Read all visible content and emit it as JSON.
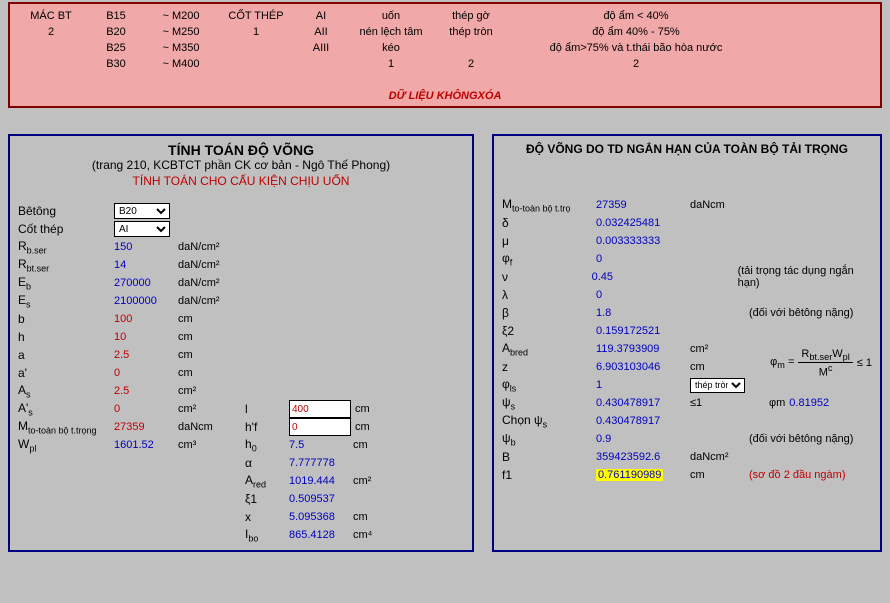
{
  "top": {
    "cols": [
      {
        "h": "MÁC BT",
        "r": [
          "2",
          "",
          "",
          ""
        ]
      },
      {
        "h": "B15",
        "r": [
          "B20",
          "B25",
          "B30",
          ""
        ]
      },
      {
        "h": "~ M200",
        "r": [
          "~ M250",
          "~ M350",
          "~ M400",
          ""
        ]
      },
      {
        "h": "CỐT THÉP",
        "r": [
          "1",
          "",
          "",
          ""
        ]
      },
      {
        "h": "AI",
        "r": [
          "AII",
          "AIII",
          "",
          ""
        ]
      },
      {
        "h": "uốn",
        "r": [
          "nén lệch tâm",
          "kéo",
          "1",
          ""
        ]
      },
      {
        "h": "thép gờ",
        "r": [
          "thép tròn",
          "",
          "2",
          ""
        ]
      },
      {
        "h": "độ ẩm < 40%",
        "r": [
          "độ ẩm 40% - 75%",
          "độ ẩm>75% và t.thái bão hòa nước",
          "2",
          ""
        ]
      }
    ],
    "footer": "DỮ LIỆU KHÔNGXÓA"
  },
  "left": {
    "title": "TÍNH TOÁN ĐỘ VÕNG",
    "sub1": "(trang 210, KCBTCT phần CK cơ bản - Ngô Thế Phong)",
    "sub2": "TÍNH TOÁN CHO CẤU KIỆN CHỊU UỐN",
    "bt_label": "Bêtông",
    "bt_sel": "B20",
    "ct_label": "Cốt thép",
    "ct_sel": "AI",
    "rows": [
      {
        "lab": "R<sub>b.ser</sub>",
        "val": "150",
        "unit": "daN/cm²",
        "red": false
      },
      {
        "lab": "R<sub>bt.ser</sub>",
        "val": "14",
        "unit": "daN/cm²",
        "red": false
      },
      {
        "lab": "E<sub>b</sub>",
        "val": "270000",
        "unit": "daN/cm²",
        "red": false
      },
      {
        "lab": "E<sub>s</sub>",
        "val": "2100000",
        "unit": "daN/cm²",
        "red": false
      },
      {
        "lab": "b",
        "val": "100",
        "unit": "cm",
        "red": true
      },
      {
        "lab": "h",
        "val": "10",
        "unit": "cm",
        "red": true
      },
      {
        "lab": "a",
        "val": "2.5",
        "unit": "cm",
        "red": true
      },
      {
        "lab": "a'",
        "val": "0",
        "unit": "cm",
        "red": true
      },
      {
        "lab": "A<sub>s</sub>",
        "val": "2.5",
        "unit": "cm²",
        "red": true
      },
      {
        "lab": "A'<sub>s</sub>",
        "val": "0",
        "unit": "cm²",
        "red": true
      },
      {
        "lab": "M<sub>to-toàn bộ t.trọng</sub>",
        "val": "27359",
        "unit": "daNcm",
        "red": true
      },
      {
        "lab": "W<sub>pl</sub>",
        "val": "1601.52",
        "unit": "cm³",
        "red": false
      }
    ],
    "col2": [
      {
        "lab": "l",
        "val": "400",
        "unit": "cm",
        "red": true,
        "inp": true
      },
      {
        "lab": "h'f",
        "val": "0",
        "unit": "cm",
        "red": true,
        "inp": true
      },
      {
        "lab": "h<sub>0</sub>",
        "val": "7.5",
        "unit": "cm",
        "red": false,
        "inp": false
      },
      {
        "lab": "α",
        "val": "7.777778",
        "unit": "",
        "red": false,
        "inp": false
      },
      {
        "lab": "A<sub>red</sub>",
        "val": "1019.444",
        "unit": "cm²",
        "red": false,
        "inp": false
      },
      {
        "lab": "ξ1",
        "val": "0.509537",
        "unit": "",
        "red": false,
        "inp": false
      },
      {
        "lab": "x",
        "val": "5.095368",
        "unit": "cm",
        "red": false,
        "inp": false
      },
      {
        "lab": "I<sub>bo</sub>",
        "val": "865.4128",
        "unit": "cm⁴",
        "red": false,
        "inp": false
      }
    ]
  },
  "right": {
    "title": "ĐỘ VÕNG DO TD NGẮN HẠN CỦA TOÀN BỘ TẢI TRỌNG",
    "rows": [
      {
        "lab": "M<sub>to-toàn bộ t.trọ</sub>",
        "val": "27359",
        "unit": "daNcm"
      },
      {
        "lab": "δ",
        "val": "0.032425481",
        "unit": ""
      },
      {
        "lab": "μ",
        "val": "0.003333333",
        "unit": ""
      },
      {
        "lab": "φ<sub>f</sub>",
        "val": "0",
        "unit": ""
      },
      {
        "lab": "ν",
        "val": "0.45",
        "unit": "",
        "extra": "(tải trọng tác dụng ngắn hạn)"
      },
      {
        "lab": "λ",
        "val": "0",
        "unit": ""
      },
      {
        "lab": "β",
        "val": "1.8",
        "unit": "",
        "extra": "(đối với bêtông nặng)"
      },
      {
        "lab": "ξ2",
        "val": "0.159172521",
        "unit": ""
      },
      {
        "lab": "A<sub>bred</sub>",
        "val": "119.3793909",
        "unit": "cm²"
      },
      {
        "lab": "z",
        "val": "6.903103046",
        "unit": "cm"
      },
      {
        "lab": "φ<sub>ls</sub>",
        "val": "1",
        "unit": "",
        "sel": "thép tròn"
      },
      {
        "lab": "ψ<sub>s</sub>",
        "val": "0.430478917",
        "unit": "≤1",
        "phim_lab": "φm",
        "phim_val": "0.81952"
      },
      {
        "lab": "Chọn ψ<sub>s</sub>",
        "val": "0.430478917",
        "unit": ""
      },
      {
        "lab": "ψ<sub>b</sub>",
        "val": "0.9",
        "unit": "",
        "extra": "(đối với bêtông nặng)"
      },
      {
        "lab": "B",
        "val": "359423592.6",
        "unit": "daNcm²"
      },
      {
        "lab": "f1",
        "val": "0.761190989",
        "unit": "cm",
        "hl": true,
        "extra": "(sơ đồ 2 đầu ngàm)",
        "extraRed": true
      }
    ],
    "formula": {
      "top": "R<sub>bt.ser</sub>W<sub>pl</sub>",
      "bot": "M<sup>c</sup>",
      "pre": "φ<sub>m</sub> =",
      "suf": "≤ 1"
    }
  }
}
